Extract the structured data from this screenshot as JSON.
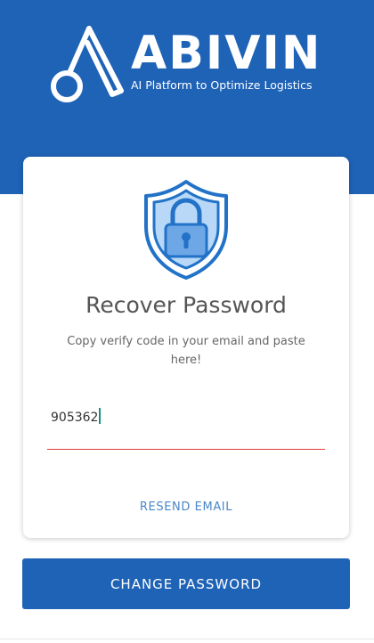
{
  "brand": {
    "name": "ABIVIN",
    "tagline": "AI Platform to Optimize Logistics"
  },
  "recover": {
    "title": "Recover Password",
    "subtitle": "Copy verify code in your email and paste here!",
    "code_value": "905362",
    "resend_label": "RESEND EMAIL"
  },
  "actions": {
    "change_password_label": "CHANGE PASSWORD"
  },
  "colors": {
    "brand_blue": "#1f63b7",
    "link_blue": "#4a86c7",
    "error_red": "#e23b3b",
    "caret_teal": "#1d8f7e"
  },
  "icons": {
    "logo_mark": "abivin-logo-icon",
    "shield": "shield-lock-icon"
  }
}
